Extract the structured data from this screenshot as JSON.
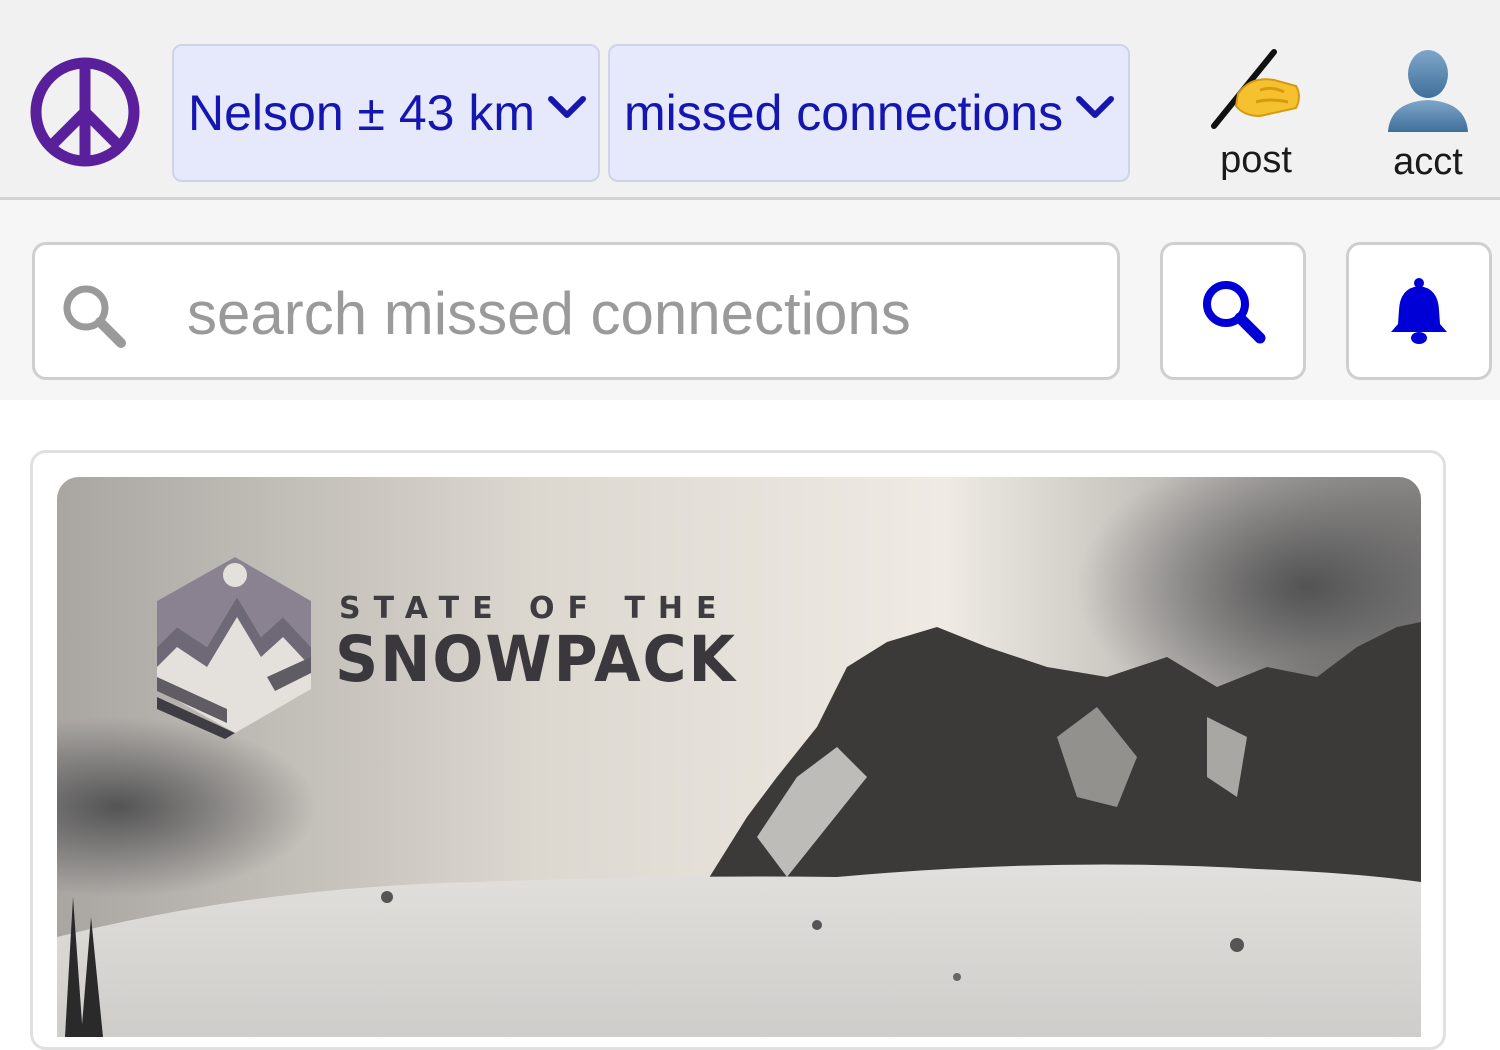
{
  "header": {
    "area_label": "Nelson ± 43 km",
    "category_label": "missed connections",
    "post_label": "post",
    "acct_label": "acct"
  },
  "search": {
    "placeholder": "search missed connections"
  },
  "banner": {
    "small_text": "STATE OF THE",
    "big_text": "SNOWPACK"
  },
  "icons": {
    "logo": "peace-sign-icon",
    "post": "writing-hand-icon",
    "acct": "user-silhouette-icon",
    "search_field": "magnifier-icon",
    "search_button": "magnifier-icon",
    "alert_button": "bell-icon"
  },
  "colors": {
    "logo": "#5a1f9a",
    "dropdown_bg": "#e6e9fc",
    "link_blue": "#1515b0",
    "button_icon": "#0000d6"
  }
}
